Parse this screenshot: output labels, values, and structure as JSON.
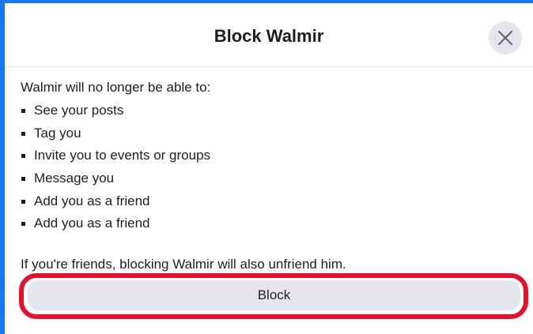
{
  "dialog": {
    "title": "Block Walmir",
    "close_icon": "close-icon",
    "intro": "Walmir will no longer be able to:",
    "items": [
      "See your posts",
      "Tag you",
      "Invite you to events or groups",
      "Message you",
      "Add you as a friend",
      "Add you as a friend"
    ],
    "note": "If you're friends, blocking Walmir will also unfriend him.",
    "block_label": "Block"
  },
  "colors": {
    "accent_border": "#1877f2",
    "highlight": "#e8112d",
    "button_bg": "#e4e6eb"
  }
}
